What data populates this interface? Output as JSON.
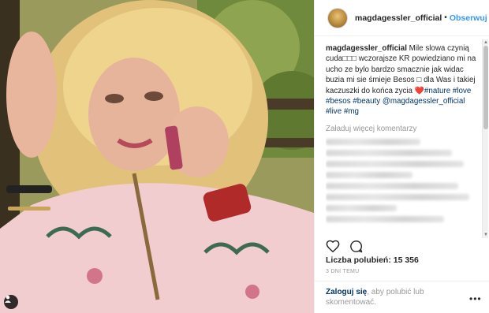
{
  "header": {
    "username": "magdagessler_official",
    "separator": "•",
    "follow_label": "Obserwuj"
  },
  "caption": {
    "username": "magdagessler_official",
    "text": " Mile slowa czynią cuda□□□ wczorajsze KR powiedziano mi na ucho ze bylo bardzo smacznie jak widac buzia mi sie śmieje Besos □ dla Was i takiej kaczuszki do końca zycia ❤️",
    "hashtags": "#nature #love #besos #beauty",
    "tail": "@magdagessler_official #live #mg"
  },
  "load_more": "Załaduj więcej komentarzy",
  "likes": "Liczba polubień: 15 356",
  "time": "3 DNI TEMU",
  "login": {
    "link": "Zaloguj się",
    "text": ", aby polubić lub skomentować."
  },
  "more_dots": "•••",
  "icons": [
    "heart-icon",
    "comment-icon",
    "user-tag-icon",
    "more-options-icon"
  ],
  "colors": {
    "accent": "#3897f0",
    "link": "#003569",
    "muted": "#999999"
  }
}
